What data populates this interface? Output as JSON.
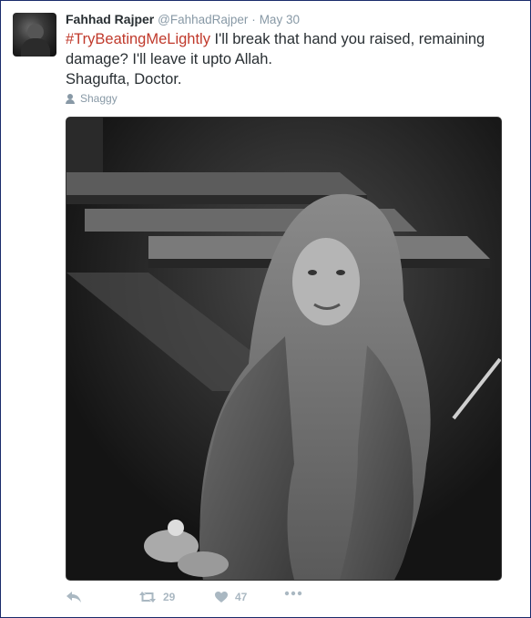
{
  "tweet": {
    "author_name": "Fahhad Rajper",
    "author_handle": "@FahhadRajper",
    "separator": "·",
    "date": "May 30",
    "hashtag": "#TryBeatingMeLightly",
    "text_line1_rest": " I'll break that hand you raised, remaining damage? I'll leave it upto Allah.",
    "text_line2": "Shagufta, Doctor.",
    "location": "Shaggy"
  },
  "actions": {
    "retweet_count": "29",
    "like_count": "47"
  },
  "icons": {
    "avatar": "user-avatar",
    "location": "person-icon",
    "reply": "reply-icon",
    "retweet": "retweet-icon",
    "like": "heart-icon",
    "more": "more-dots-icon"
  },
  "colors": {
    "hashtag": "#c0392b",
    "muted": "#8899a6",
    "action": "#aab8c2",
    "frame_border": "#1a2b6b"
  }
}
